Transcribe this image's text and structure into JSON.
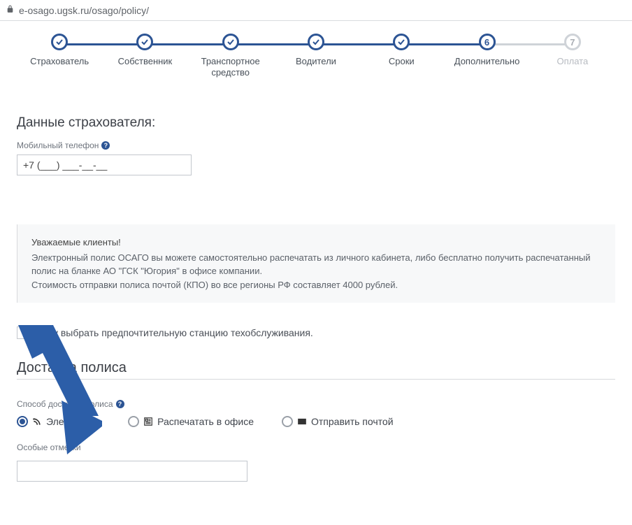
{
  "address": {
    "host": "e-osago.ugsk.ru",
    "path": "/osago/policy/"
  },
  "steps": [
    {
      "label": "Страхователь",
      "state": "done"
    },
    {
      "label": "Собственник",
      "state": "done"
    },
    {
      "label": "Транспортное\nсредство",
      "state": "done"
    },
    {
      "label": "Водители",
      "state": "done"
    },
    {
      "label": "Сроки",
      "state": "done"
    },
    {
      "label": "Дополнительно",
      "state": "current",
      "num": "6"
    },
    {
      "label": "Оплата",
      "state": "future",
      "num": "7"
    }
  ],
  "insurer": {
    "heading": "Данные страхователя:",
    "phone_label": "Мобильный телефон",
    "phone_value": "+7 (___) ___-__-__"
  },
  "notice": {
    "title": "Уважаемые клиенты!",
    "line1": "Электронный полис ОСАГО вы можете самостоятельно распечатать из личного кабинета, либо бесплатно получить распечатанный полис на бланке АО \"ГСК \"Югория\" в офисе компании.",
    "line2": "Стоимость отправки полиса почтой (КПО) во все регионы РФ составляет 4000 рублей."
  },
  "checkbox": {
    "label": "Хочу выбрать предпочтительную станцию техобслуживания."
  },
  "delivery": {
    "heading": "Доставка полиса",
    "method_label": "Способ доставки полиса",
    "options": [
      {
        "label": "Электронно",
        "selected": true
      },
      {
        "label": "Распечатать в офисе",
        "selected": false
      },
      {
        "label": "Отправить почтой",
        "selected": false
      }
    ],
    "notes_label": "Особые отметки",
    "notes_value": ""
  }
}
